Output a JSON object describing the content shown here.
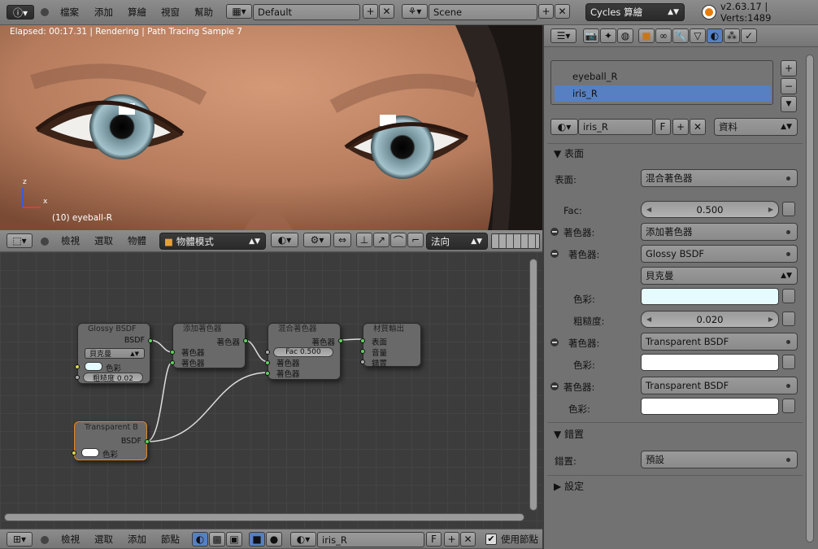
{
  "topbar": {
    "menus": [
      "檔案",
      "添加",
      "算繪",
      "視窗",
      "幫助"
    ],
    "screen_layout": "Default",
    "scene": "Scene",
    "render_engine": "Cycles 算繪",
    "version_info": "v2.63.17 | Verts:1489"
  },
  "viewport": {
    "render_status": "Elapsed: 00:17.31 | Rendering | Path Tracing Sample 7",
    "object_label": "(10) eyeball-R",
    "axis_z": "z",
    "axis_x": "x"
  },
  "viewport_header": {
    "menus": [
      "檢視",
      "選取",
      "物體"
    ],
    "mode": "物體模式",
    "orientation": "法向"
  },
  "node_editor": {
    "nodes": {
      "glossy": {
        "title": "Glossy BSDF",
        "output": "BSDF",
        "distribution": "貝克曼",
        "color_label": "色彩",
        "roughness": "粗糙度 0.02"
      },
      "add": {
        "title": "添加著色器",
        "output": "著色器",
        "in1": "著色器",
        "in2": "著色器"
      },
      "mix": {
        "title": "混合著色器",
        "output": "著色器",
        "fac": "Fac 0.500",
        "in1": "著色器",
        "in2": "著色器"
      },
      "output": {
        "title": "材質輸出",
        "surface": "表面",
        "volume": "音量",
        "displacement": "錯置"
      },
      "transparent": {
        "title": "Transparent B",
        "output": "BSDF",
        "color_label": "色彩"
      }
    }
  },
  "node_header": {
    "menus": [
      "檢視",
      "選取",
      "添加",
      "節點"
    ],
    "material": "iris_R",
    "fake_user": "F",
    "use_nodes": "使用節點"
  },
  "properties": {
    "material_slots": [
      "eyeball_R",
      "iris_R"
    ],
    "selected_slot": "iris_R",
    "material_name": "iris_R",
    "fake_user": "F",
    "link": "資料",
    "surface_panel": {
      "title": "表面",
      "surface_label": "表面:",
      "surface_value": "混合著色器",
      "fac_label": "Fac:",
      "fac_value": "0.500",
      "shader1_label": "著色器:",
      "shader1_value": "添加著色器",
      "shader2_label": "著色器:",
      "shader2_value": "Glossy BSDF",
      "distribution": "貝克曼",
      "color_label": "色彩:",
      "roughness_label": "粗糙度:",
      "roughness_value": "0.020",
      "shader3_label": "著色器:",
      "shader3_value": "Transparent BSDF",
      "color2_label": "色彩:",
      "shader4_label": "著色器:",
      "shader4_value": "Transparent BSDF",
      "color3_label": "色彩:"
    },
    "displacement_panel": {
      "title": "錯置",
      "label": "錯置:",
      "value": "預設"
    },
    "settings_panel": {
      "title": "設定"
    }
  },
  "colors": {
    "selection": "#5680c2",
    "glossy_color": "#e6fbfd",
    "white": "#ffffff"
  }
}
